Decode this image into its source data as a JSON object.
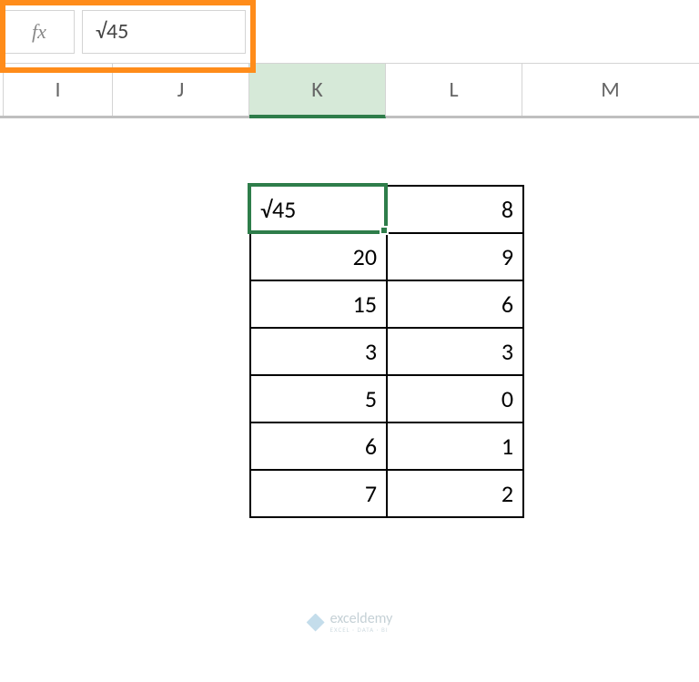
{
  "formula_bar": {
    "fx_label": "fx",
    "value": "√45"
  },
  "columns": {
    "I": "I",
    "J": "J",
    "K": "K",
    "L": "L",
    "M": "M"
  },
  "selected_cell": {
    "address": "K1",
    "display": "√45"
  },
  "chart_data": {
    "type": "table",
    "columns": [
      "K",
      "L"
    ],
    "rows": [
      {
        "K": "√45",
        "L": 8
      },
      {
        "K": 20,
        "L": 9
      },
      {
        "K": 15,
        "L": 6
      },
      {
        "K": 3,
        "L": 3
      },
      {
        "K": 5,
        "L": 0
      },
      {
        "K": 6,
        "L": 1
      },
      {
        "K": 7,
        "L": 2
      }
    ]
  },
  "watermark": {
    "main": "exceldemy",
    "sub": "EXCEL · DATA · BI"
  }
}
